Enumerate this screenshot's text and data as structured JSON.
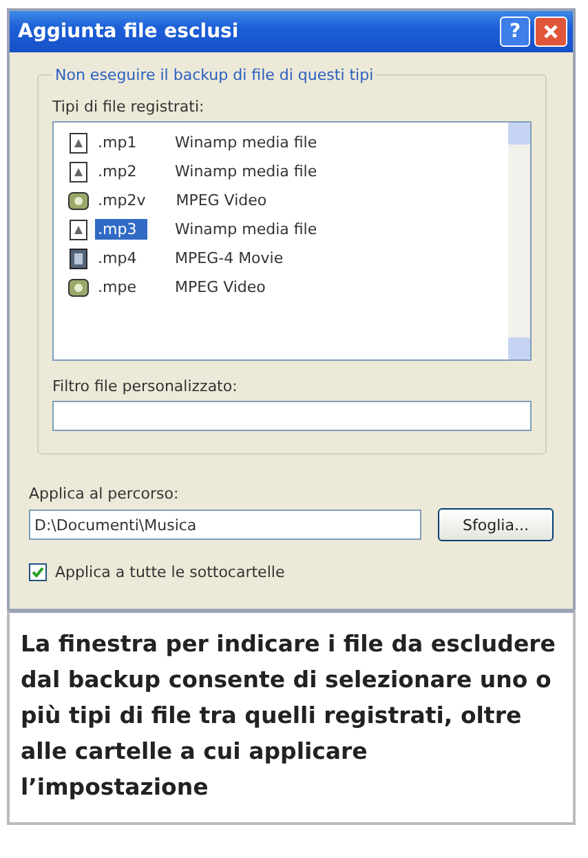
{
  "window": {
    "title": "Aggiunta file esclusi",
    "help_button": "?"
  },
  "group": {
    "label": "Non eseguire il backup di file di questi tipi",
    "list_label": "Tipi di file registrati:",
    "file_types": [
      {
        "extension": ".mp1",
        "description": "Winamp media file",
        "kind": "audio",
        "selected": false
      },
      {
        "extension": ".mp2",
        "description": "Winamp media file",
        "kind": "audio",
        "selected": false
      },
      {
        "extension": ".mp2v",
        "description": "MPEG Video",
        "kind": "video",
        "selected": false
      },
      {
        "extension": ".mp3",
        "description": "Winamp media file",
        "kind": "audio",
        "selected": true
      },
      {
        "extension": ".mp4",
        "description": "MPEG-4 Movie",
        "kind": "movie",
        "selected": false
      },
      {
        "extension": ".mpe",
        "description": "MPEG Video",
        "kind": "video",
        "selected": false
      }
    ],
    "filter_label": "Filtro file personalizzato:"
  },
  "path": {
    "label": "Applica al percorso:",
    "value": "D:\\Documenti\\Musica",
    "browse_button": "Sfoglia..."
  },
  "subfolders": {
    "label": "Applica a tutte le sottocartelle",
    "checked": true
  },
  "caption": "La finestra per indicare i file da escludere dal backup consente di selezionare uno o più tipi di file tra quelli registrati, oltre alle cartelle a cui applicare l’impostazione"
}
